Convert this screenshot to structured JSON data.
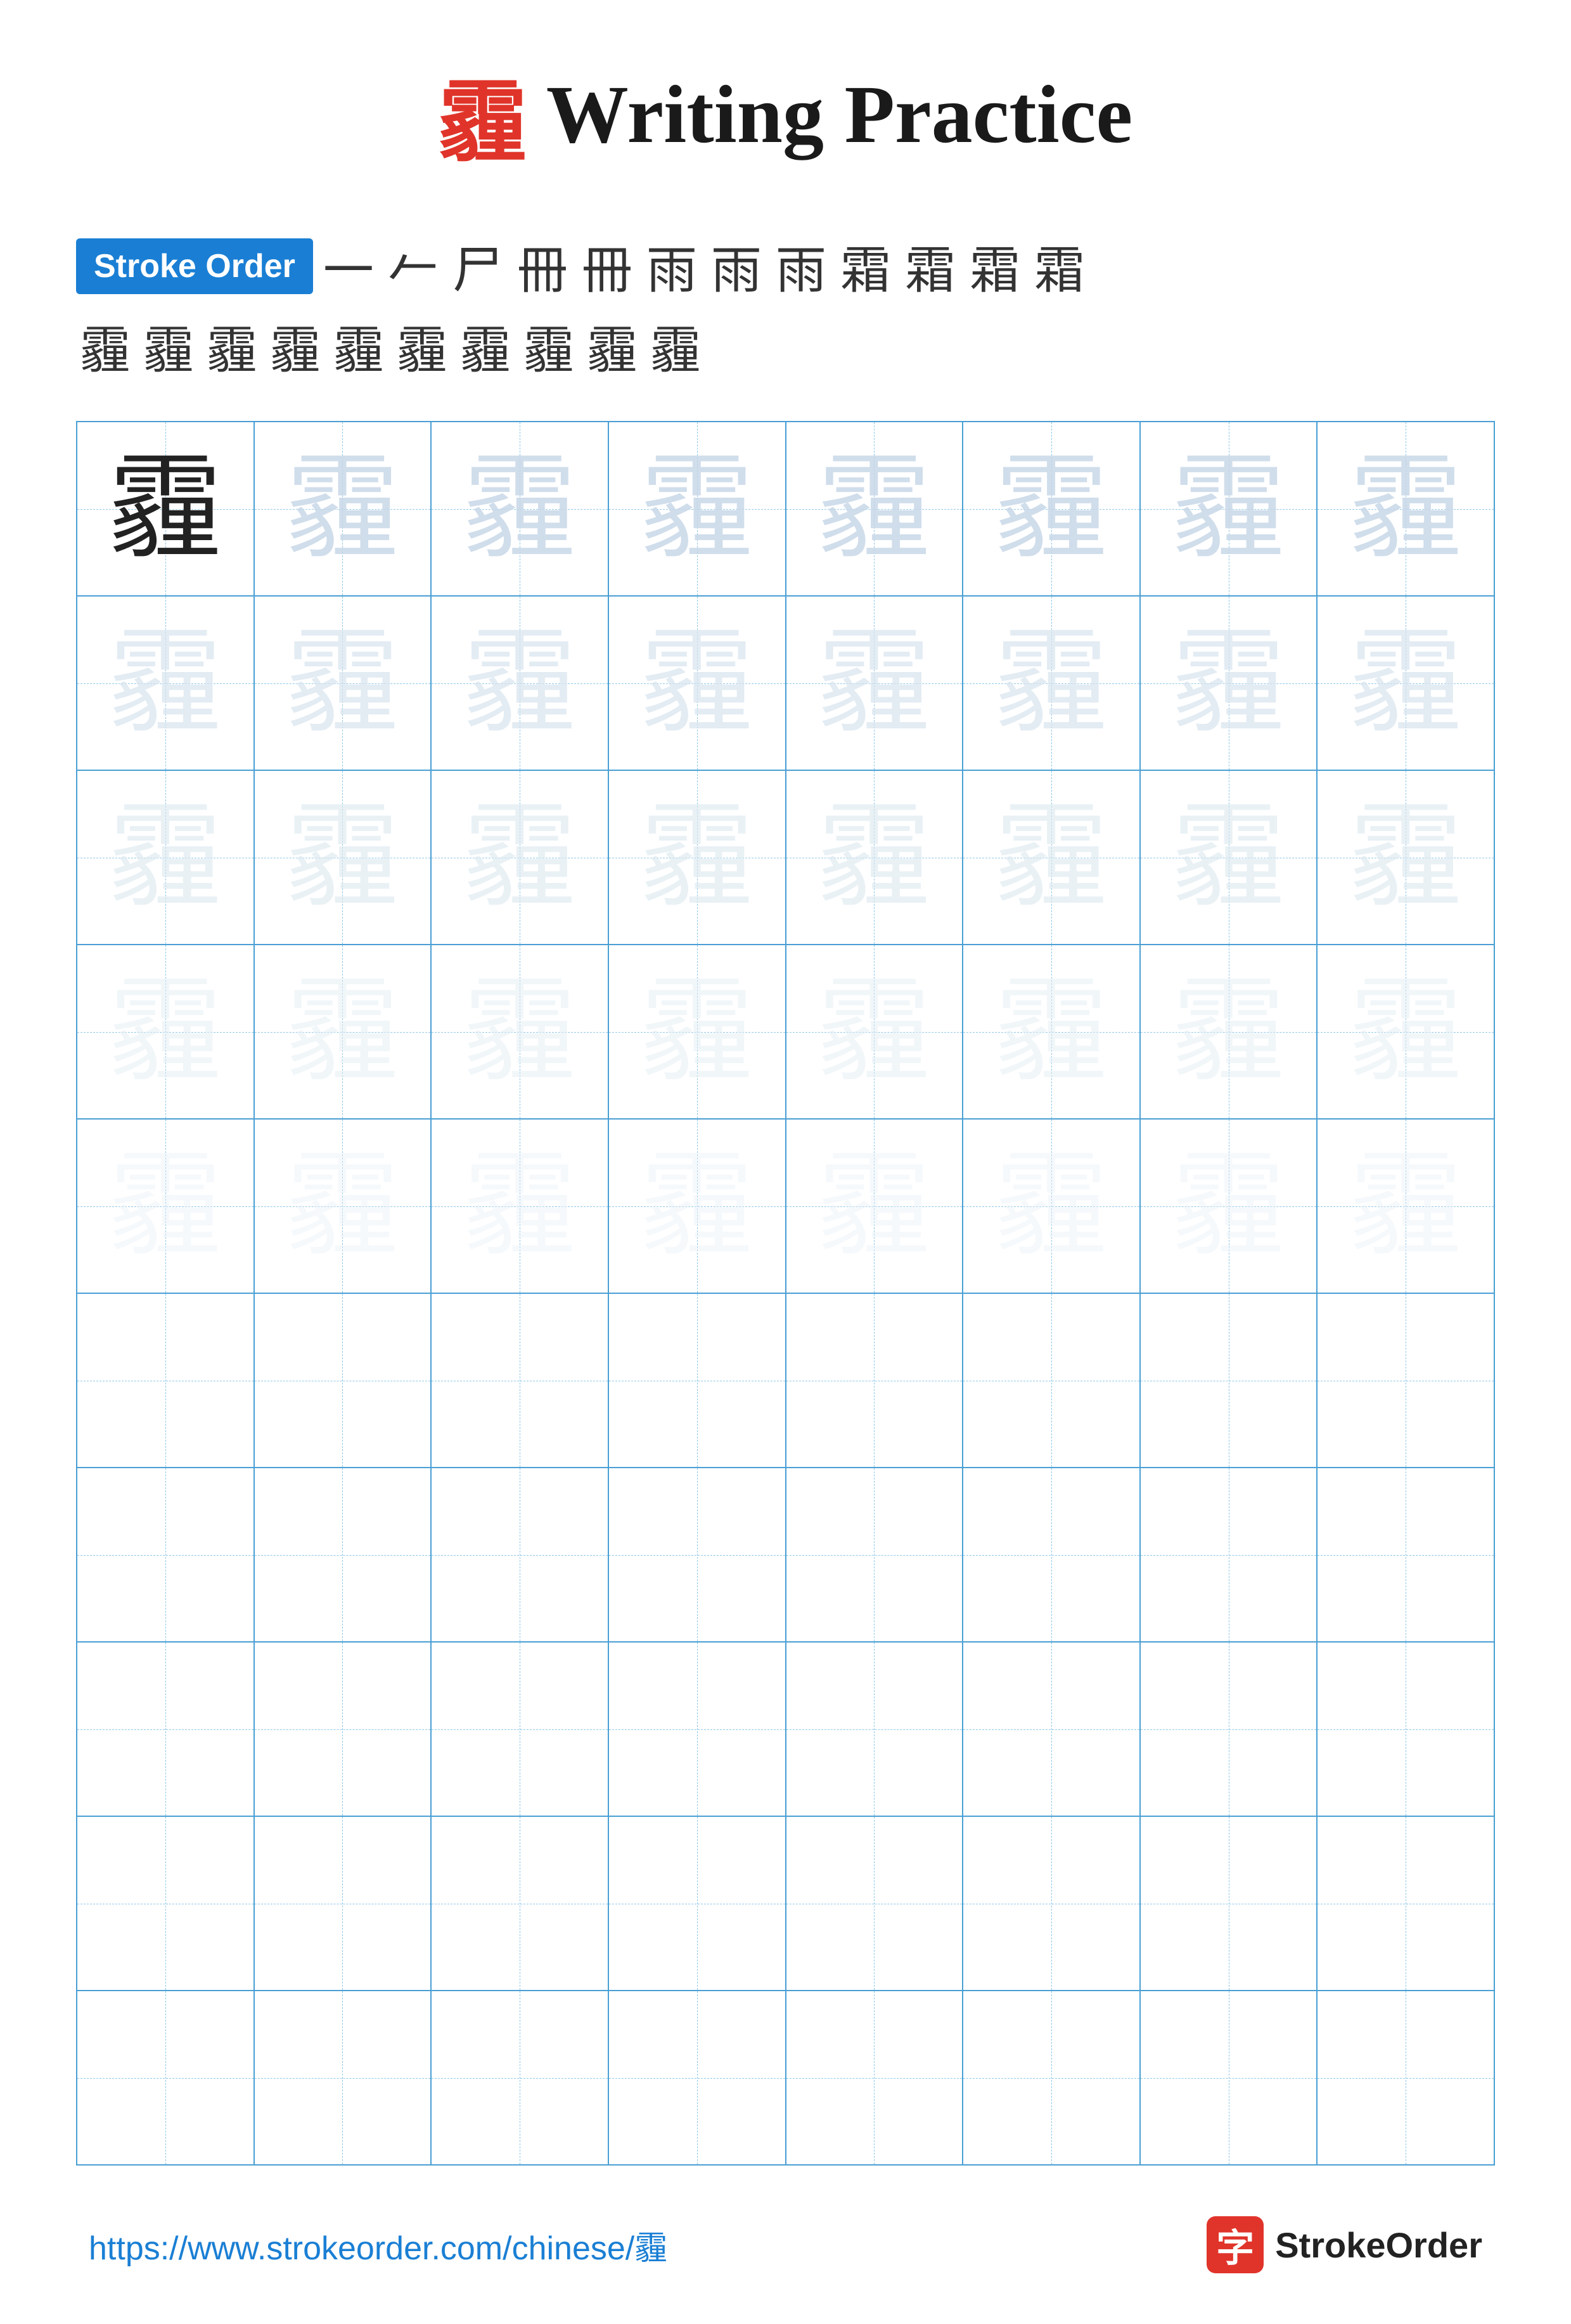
{
  "page": {
    "title": {
      "char": "霾",
      "text": "Writing Practice"
    },
    "stroke_order": {
      "badge_label": "Stroke Order",
      "row1_chars": [
        "一",
        "𠂉",
        "尸",
        "冊",
        "冊",
        "冊",
        "雨",
        "雨",
        "雨",
        "雨",
        "霾",
        "霾"
      ],
      "row2_chars": [
        "霾",
        "霾",
        "霾",
        "霾",
        "霾",
        "霾",
        "霾",
        "霾",
        "霾",
        "霾"
      ]
    },
    "grid": {
      "rows": 10,
      "cols": 8,
      "char": "霾",
      "guide_char_rows": [
        "dark",
        "light1",
        "light2",
        "light3",
        "light4",
        "empty",
        "empty",
        "empty",
        "empty",
        "empty"
      ]
    },
    "footer": {
      "url": "https://www.strokeorder.com/chinese/霾",
      "brand": "StrokeOrder"
    }
  }
}
